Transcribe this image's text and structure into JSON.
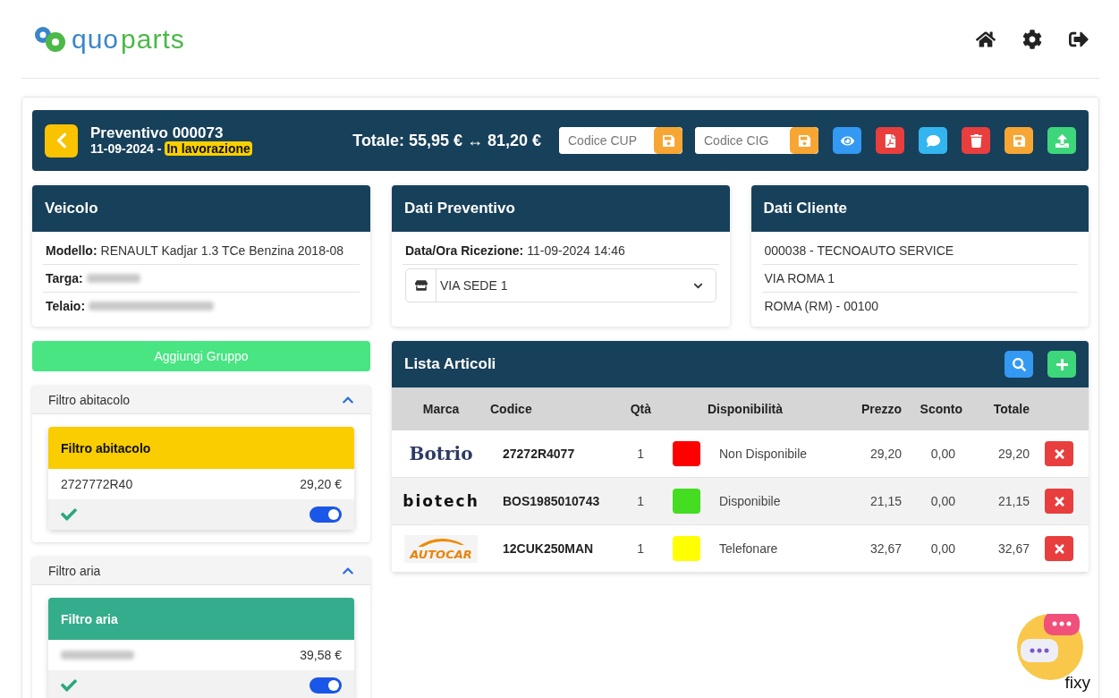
{
  "brand": {
    "name_part_1": "quo",
    "name_part_2": "parts"
  },
  "nav": [
    {
      "kind": "home"
    },
    {
      "kind": "settings"
    },
    {
      "kind": "logout"
    }
  ],
  "quote": {
    "title": "Preventivo 000073",
    "date": "11-09-2024 -",
    "status": "In lavorazione",
    "total": "Totale: 55,95 € ↔ 81,20 €",
    "fields": [
      {
        "placeholder": "Codice CUP"
      },
      {
        "placeholder": "Codice CIG"
      }
    ],
    "actions": [
      {
        "kind": "view",
        "color": "#3399f3"
      },
      {
        "kind": "pdf",
        "color": "#e83e3e"
      },
      {
        "kind": "chat",
        "color": "#33b5f0"
      },
      {
        "kind": "delete",
        "color": "#e83e3e"
      },
      {
        "kind": "save",
        "color": "#f7a634"
      },
      {
        "kind": "upload",
        "color": "#3ed67a"
      }
    ]
  },
  "vehicle": {
    "title": "Veicolo",
    "rows": [
      {
        "label": "Modello:",
        "value": "RENAULT Kadjar 1.3 TCe Benzina 2018-08",
        "blurred": false
      },
      {
        "label": "Targa:",
        "blurred": true
      },
      {
        "label": "Telaio:",
        "blurred": true
      }
    ]
  },
  "quote_data": {
    "title": "Dati Preventivo",
    "label": "Data/Ora Ricezione:",
    "value": "11-09-2024 14:46",
    "branch": "VIA SEDE 1"
  },
  "client": {
    "title": "Dati Cliente",
    "lines": [
      "000038 - TECNOAUTO SERVICE",
      "VIA ROMA 1",
      "ROMA (RM) - 00100"
    ]
  },
  "add_group": "Aggiungi Gruppo",
  "groups": [
    {
      "title": "Filtro abitacolo",
      "expanded": true,
      "card_title": "Filtro abitacolo",
      "color": "#f9cd00",
      "code": "2727772R40",
      "code_blurred": false,
      "price": "29,20 €",
      "confirmed": true,
      "on": true
    },
    {
      "title": "Filtro aria",
      "expanded": true,
      "card_title": "Filtro aria",
      "color": "#34ad8c",
      "code_blurred": true,
      "price": "39,58 €",
      "confirmed": true,
      "on": true
    }
  ],
  "articles": {
    "title": "Lista Articoli",
    "columns": [
      "Marca",
      "Codice",
      "Qtà",
      "Disponibilità",
      "Prezzo",
      "Sconto",
      "Totale"
    ],
    "rows": [
      {
        "brand": "Botrio",
        "kind": "botrio",
        "code": "27272R4077",
        "qty": "1",
        "availability": "Non Disponibile",
        "color": "#ff0000",
        "price": "29,20",
        "discount": "0,00",
        "total": "29,20"
      },
      {
        "brand": "biotech",
        "kind": "biotech",
        "code": "BOS1985010743",
        "qty": "1",
        "availability": "Disponibile",
        "color": "#44dd22",
        "price": "21,15",
        "discount": "0,00",
        "total": "21,15"
      },
      {
        "brand": "AUTOCAR",
        "kind": "autocar",
        "code": "12CUK250MAN",
        "qty": "1",
        "availability": "Telefonare",
        "color": "#ffff00",
        "price": "32,67",
        "discount": "0,00",
        "total": "32,67"
      }
    ]
  },
  "widget": {
    "label": "fixy"
  }
}
